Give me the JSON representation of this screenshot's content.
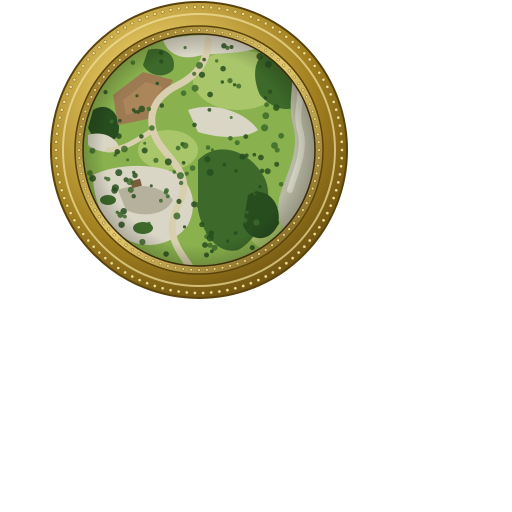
{
  "minimap": {
    "frame": {
      "style": "ornate-gold-round",
      "colors": {
        "gold_light": "#f4e7a2",
        "gold_mid": "#d4b552",
        "gold_dark": "#8a6a16",
        "gold_deep": "#5a430c",
        "bead": "#f0de8a"
      }
    },
    "terrain": {
      "colors": {
        "grass": "#89b24e",
        "grass_light": "#a9c66b",
        "forest": "#3d6a2a",
        "forest_dark": "#274d1f",
        "rock": "#d9d6c6",
        "rock_shadow": "#b5b19c",
        "path": "#d8cfae",
        "dirt_field": "#9d7a52",
        "river": "#b8b9a4",
        "river_light": "#d7d8c8"
      }
    }
  }
}
